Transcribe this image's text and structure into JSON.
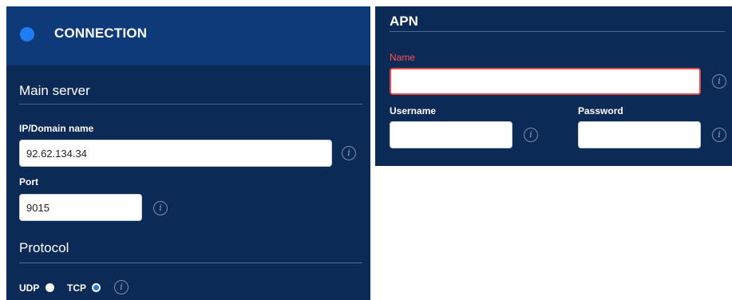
{
  "connection": {
    "title": "CONNECTION",
    "main_server": {
      "title": "Main server",
      "ip_label": "IP/Domain name",
      "ip_value": "92.62.134.34",
      "port_label": "Port",
      "port_value": "9015"
    },
    "protocol": {
      "title": "Protocol",
      "options": [
        {
          "label": "UDP",
          "selected": false
        },
        {
          "label": "TCP",
          "selected": true
        }
      ]
    }
  },
  "apn": {
    "title": "APN",
    "name_label": "Name",
    "name_value": "",
    "username_label": "Username",
    "username_value": "",
    "password_label": "Password",
    "password_value": ""
  },
  "colors": {
    "panel_bg": "#0b2a55",
    "header_bg": "#0e3a7a",
    "accent": "#1f7ef2",
    "error": "#e24b4b"
  }
}
